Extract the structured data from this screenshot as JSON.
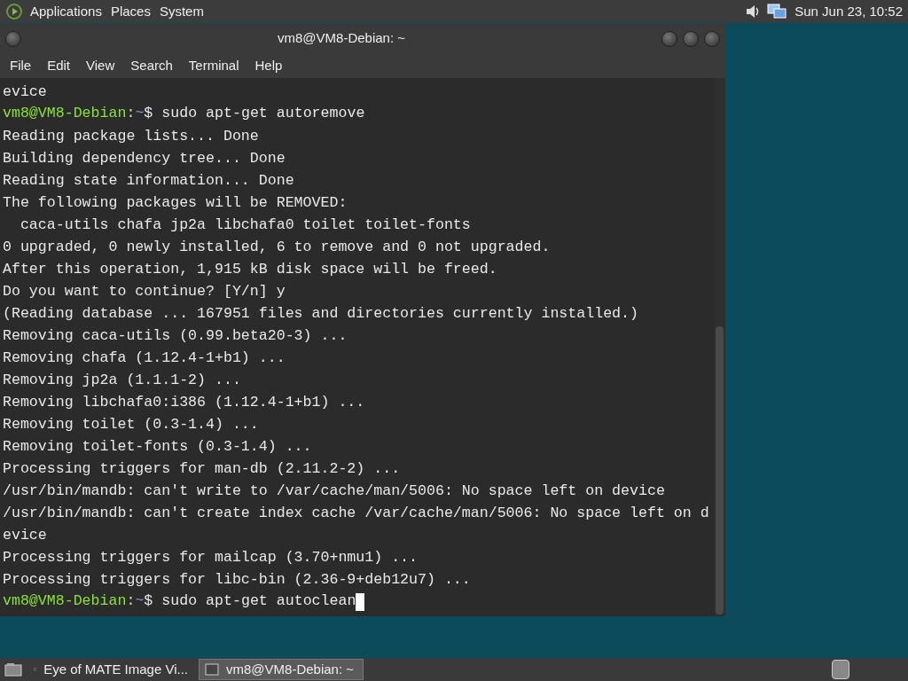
{
  "top_panel": {
    "menus": [
      "Applications",
      "Places",
      "System"
    ],
    "clock": "Sun Jun 23, 10:52"
  },
  "window": {
    "title": "vm8@VM8-Debian: ~",
    "menu": [
      "File",
      "Edit",
      "View",
      "Search",
      "Terminal",
      "Help"
    ]
  },
  "terminal": {
    "lines": [
      {
        "kind": "output",
        "text": "evice"
      },
      {
        "kind": "prompt",
        "user_host": "vm8@VM8-Debian",
        "separator": ":",
        "path": "~",
        "symbol": "$",
        "command": "sudo apt-get autoremove",
        "cursor": false
      },
      {
        "kind": "output",
        "text": "Reading package lists... Done"
      },
      {
        "kind": "output",
        "text": "Building dependency tree... Done"
      },
      {
        "kind": "output",
        "text": "Reading state information... Done"
      },
      {
        "kind": "output",
        "text": "The following packages will be REMOVED:"
      },
      {
        "kind": "output",
        "text": "  caca-utils chafa jp2a libchafa0 toilet toilet-fonts"
      },
      {
        "kind": "output",
        "text": "0 upgraded, 0 newly installed, 6 to remove and 0 not upgraded."
      },
      {
        "kind": "output",
        "text": "After this operation, 1,915 kB disk space will be freed."
      },
      {
        "kind": "output",
        "text": "Do you want to continue? [Y/n] y"
      },
      {
        "kind": "output",
        "text": "(Reading database ... 167951 files and directories currently installed.)"
      },
      {
        "kind": "output",
        "text": "Removing caca-utils (0.99.beta20-3) ..."
      },
      {
        "kind": "output",
        "text": "Removing chafa (1.12.4-1+b1) ..."
      },
      {
        "kind": "output",
        "text": "Removing jp2a (1.1.1-2) ..."
      },
      {
        "kind": "output",
        "text": "Removing libchafa0:i386 (1.12.4-1+b1) ..."
      },
      {
        "kind": "output",
        "text": "Removing toilet (0.3-1.4) ..."
      },
      {
        "kind": "output",
        "text": "Removing toilet-fonts (0.3-1.4) ..."
      },
      {
        "kind": "output",
        "text": "Processing triggers for man-db (2.11.2-2) ..."
      },
      {
        "kind": "output",
        "text": "/usr/bin/mandb: can't write to /var/cache/man/5006: No space left on device"
      },
      {
        "kind": "output",
        "text": "/usr/bin/mandb: can't create index cache /var/cache/man/5006: No space left on d"
      },
      {
        "kind": "output",
        "text": "evice"
      },
      {
        "kind": "output",
        "text": "Processing triggers for mailcap (3.70+nmu1) ..."
      },
      {
        "kind": "output",
        "text": "Processing triggers for libc-bin (2.36-9+deb12u7) ..."
      },
      {
        "kind": "prompt",
        "user_host": "vm8@VM8-Debian",
        "separator": ":",
        "path": "~",
        "symbol": "$",
        "command": "sudo apt-get autoclean",
        "cursor": true
      }
    ]
  },
  "taskbar": {
    "items": [
      {
        "label": "Eye of MATE Image Vi...",
        "selected": false
      },
      {
        "label": "vm8@VM8-Debian: ~",
        "selected": true
      }
    ]
  }
}
